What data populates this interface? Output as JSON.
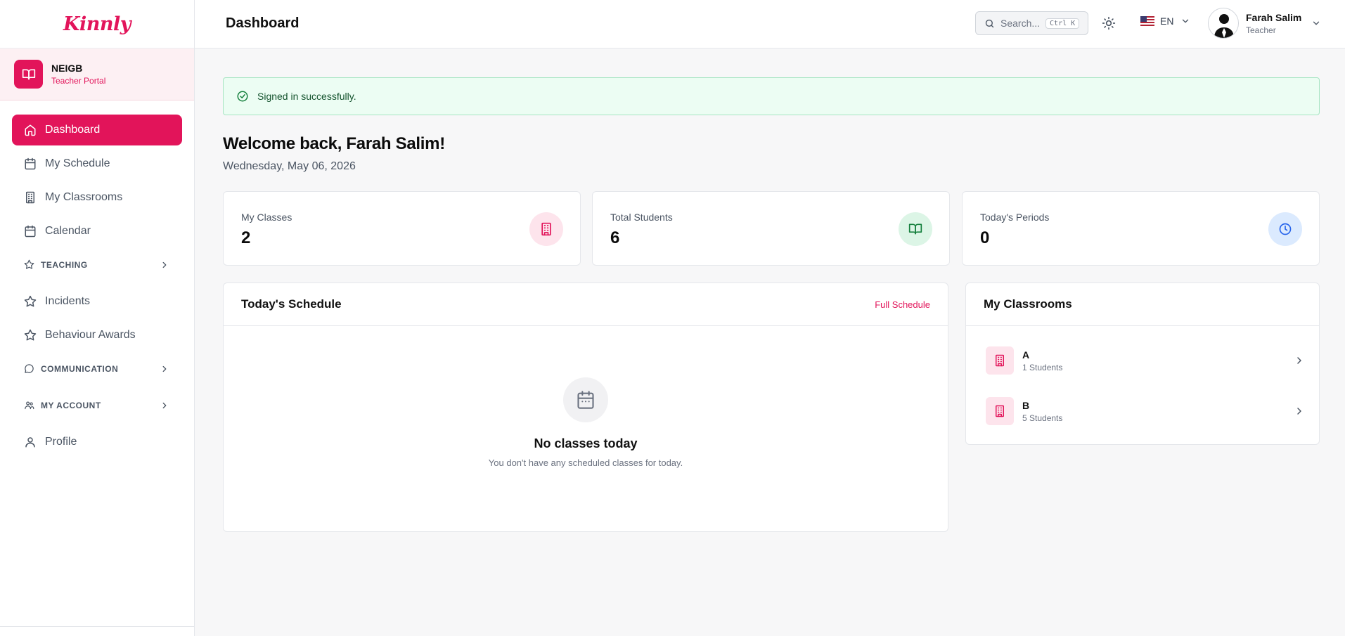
{
  "app": {
    "logo": "Kinnly"
  },
  "org": {
    "name": "NEIGB",
    "subtitle": "Teacher Portal"
  },
  "sidebar": {
    "items": [
      {
        "label": "Dashboard",
        "icon": "home-icon",
        "active": true
      },
      {
        "label": "My Schedule",
        "icon": "calendar-icon"
      },
      {
        "label": "My Classrooms",
        "icon": "building-icon"
      },
      {
        "label": "Calendar",
        "icon": "calendar-icon"
      }
    ],
    "teaching": "TEACHING",
    "incidents": "Incidents",
    "behaviour_awards": "Behaviour Awards",
    "communication": "COMMUNICATION",
    "my_account": "MY ACCOUNT",
    "profile": "Profile"
  },
  "header": {
    "title": "Dashboard",
    "search_placeholder": "Search...",
    "search_shortcut": "Ctrl K",
    "language": "EN",
    "user_name": "Farah Salim",
    "user_role": "Teacher"
  },
  "alert": {
    "text": "Signed in successfully."
  },
  "welcome": {
    "title": "Welcome back, Farah Salim!",
    "date": "Wednesday, May 06, 2026"
  },
  "stats": [
    {
      "label": "My Classes",
      "value": "2",
      "icon": "building-icon",
      "color": "#e2145a",
      "bg": "#fde4ec"
    },
    {
      "label": "Total Students",
      "value": "6",
      "icon": "book-icon",
      "color": "#15803d",
      "bg": "#dcf5e6"
    },
    {
      "label": "Today's Periods",
      "value": "0",
      "icon": "clock-icon",
      "color": "#2563eb",
      "bg": "#dbeafe"
    }
  ],
  "schedule": {
    "title": "Today's Schedule",
    "link": "Full Schedule",
    "empty_title": "No classes today",
    "empty_sub": "You don't have any scheduled classes for today."
  },
  "classrooms": {
    "title": "My Classrooms",
    "items": [
      {
        "name": "A",
        "count": "1 Students"
      },
      {
        "name": "B",
        "count": "5 Students"
      }
    ]
  },
  "colors": {
    "accent": "#e2145a",
    "success_bg": "#ecfdf3"
  }
}
